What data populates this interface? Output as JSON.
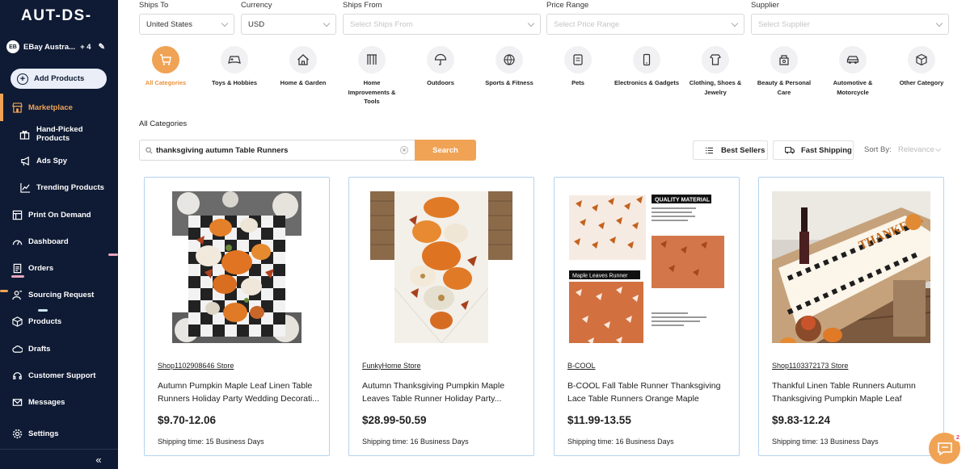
{
  "app": {
    "logo": "AUT-DS-"
  },
  "store": {
    "badge": "EB",
    "name": "EBay Austra...",
    "count": "+ 4"
  },
  "sidebar": {
    "add_products": "Add Products",
    "items": [
      {
        "label": "Marketplace",
        "icon": "store-icon"
      },
      {
        "label": "Hand-Picked Products",
        "icon": "gift-icon"
      },
      {
        "label": "Ads Spy",
        "icon": "megaphone-icon"
      },
      {
        "label": "Trending Products",
        "icon": "trending-icon"
      },
      {
        "label": "Print On Demand",
        "icon": "print-icon"
      },
      {
        "label": "Dashboard",
        "icon": "gauge-icon"
      },
      {
        "label": "Orders",
        "icon": "orders-icon"
      },
      {
        "label": "Sourcing Request",
        "icon": "sourcing-icon"
      },
      {
        "label": "Products",
        "icon": "box-icon"
      },
      {
        "label": "Drafts",
        "icon": "drafts-icon"
      },
      {
        "label": "Customer Support",
        "icon": "support-icon"
      },
      {
        "label": "Messages",
        "icon": "mail-icon"
      },
      {
        "label": "Settings",
        "icon": "gear-icon"
      }
    ],
    "collapse_icon": "«"
  },
  "filters": {
    "ships_to": {
      "label": "Ships To",
      "value": "United States"
    },
    "currency": {
      "label": "Currency",
      "value": "USD"
    },
    "ships_from": {
      "label": "Ships From",
      "placeholder": "Select Ships From"
    },
    "price_range": {
      "label": "Price Range",
      "placeholder": "Select Price Range"
    },
    "supplier": {
      "label": "Supplier",
      "placeholder": "Select Supplier"
    }
  },
  "categories": [
    {
      "label": "All Categories",
      "icon": "cart-icon",
      "selected": true
    },
    {
      "label": "Toys & Hobbies",
      "icon": "gamepad-icon"
    },
    {
      "label": "Home & Garden",
      "icon": "house-icon"
    },
    {
      "label": "Home Improvements & Tools",
      "icon": "tools-icon"
    },
    {
      "label": "Outdoors",
      "icon": "umbrella-icon"
    },
    {
      "label": "Sports & Fitness",
      "icon": "ball-icon"
    },
    {
      "label": "Pets",
      "icon": "pet-icon"
    },
    {
      "label": "Electronics & Gadgets",
      "icon": "phone-icon"
    },
    {
      "label": "Clothing, Shoes & Jewelry",
      "icon": "shirt-icon"
    },
    {
      "label": "Beauty & Personal Care",
      "icon": "beauty-icon"
    },
    {
      "label": "Automotive & Motorcycle",
      "icon": "car-icon"
    },
    {
      "label": "Other Category",
      "icon": "cube-icon"
    }
  ],
  "section_title": "All Categories",
  "search": {
    "value": "thanksgiving autumn Table Runners",
    "button": "Search"
  },
  "toolbar": {
    "best_sellers": "Best Sellers",
    "fast_shipping": "Fast Shipping",
    "sort_label": "Sort By:",
    "sort_value": "Relevance"
  },
  "products": [
    {
      "store": "Shop1102908646 Store",
      "title": "Autumn Pumpkin Maple Leaf Linen Table Runners Holiday Party Wedding Decorati...",
      "price": "$9.70-12.06",
      "shipping": "Shipping time: 15 Business Days"
    },
    {
      "store": "FunkyHome Store",
      "title": "Autumn Thanksgiving Pumpkin Maple Leaves Table Runner Holiday Party...",
      "price": "$28.99-50.59",
      "shipping": "Shipping time: 16 Business Days"
    },
    {
      "store": "B-COOL",
      "title": "B-COOL Fall Table Runner Thanksgiving Lace Table Runners Orange Maple Leave...",
      "price": "$11.99-13.55",
      "shipping": "Shipping time: 16 Business Days",
      "img_text": {
        "quality": "QUALITY MATERIAL",
        "maple": "Maple Leaves Runner"
      }
    },
    {
      "store": "Shop1103372173 Store",
      "title": "Thankful Linen Table Runners Autumn Thanksgiving Pumpkin Maple Leaf Turkey...",
      "price": "$9.83-12.24",
      "shipping": "Shipping time: 13 Business Days"
    }
  ],
  "chat": {
    "badge": "2"
  },
  "colors": {
    "accent": "#f0a355",
    "sidebar": "#0f1b34",
    "card_border": "#b5d3ef"
  }
}
